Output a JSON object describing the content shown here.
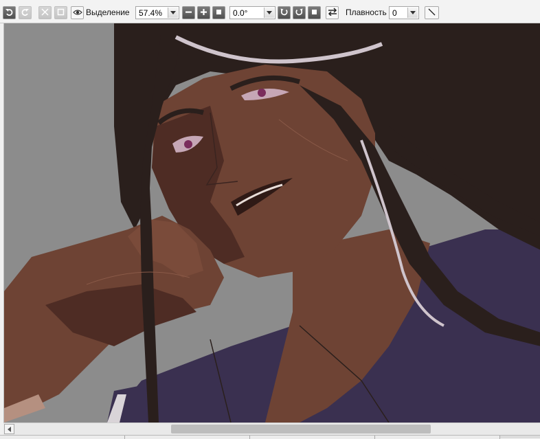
{
  "toolbar": {
    "undo_icon": "undo-icon",
    "redo_icon": "redo-icon",
    "cut_icon": "cut-icon",
    "paste_icon": "paste-icon",
    "visibility_icon": "eye-icon",
    "selection_label": "Выделение",
    "zoom_value": "57.4%",
    "zoom_out_icon": "minus-icon",
    "zoom_in_icon": "plus-icon",
    "zoom_fit_icon": "square-icon",
    "rotation_value": "0.0°",
    "rotate_ccw_icon": "rotate-ccw-icon",
    "rotate_cw_icon": "rotate-cw-icon",
    "rotate_reset_icon": "square-icon",
    "flip_icon": "flip-arrows-icon",
    "smoothing_label": "Плавность",
    "smoothing_value": "0",
    "stroke_icon": "line-tool-icon"
  },
  "colors": {
    "canvas_bg": "#8c8c8c",
    "hair": "#2a1f1c",
    "skin": "#6e4334",
    "skin_shadow": "#4e2c24",
    "robe": "#3a3050",
    "highlight": "#cfc4cc"
  }
}
